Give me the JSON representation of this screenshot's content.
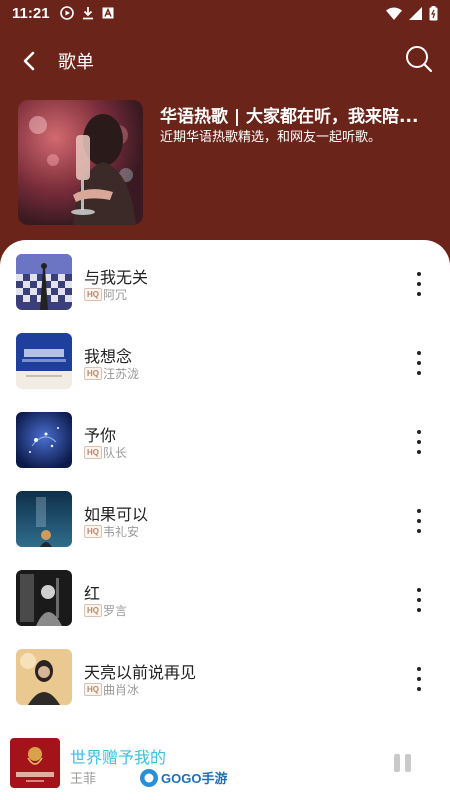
{
  "status_bar": {
    "time": "11:21",
    "icons": [
      "play-circle-icon",
      "download-icon",
      "a-icon",
      "wifi-icon",
      "signal-icon",
      "battery-icon"
    ]
  },
  "app_bar": {
    "title": "歌单",
    "back_icon": "back-arrow-icon",
    "search_icon": "search-icon"
  },
  "playlist": {
    "title": "华语热歌 | 大家都在听，我来陪...",
    "description": "近期华语热歌精选，和网友一起听歌。"
  },
  "quality_badge": "HQ",
  "songs": [
    {
      "title": "与我无关",
      "artist": "阿冗"
    },
    {
      "title": "我想念",
      "artist": "汪苏泷"
    },
    {
      "title": "予你",
      "artist": "队长"
    },
    {
      "title": "如果可以",
      "artist": "韦礼安"
    },
    {
      "title": "红",
      "artist": "罗言"
    },
    {
      "title": "天亮以前说再见",
      "artist": "曲肖冰"
    }
  ],
  "now_playing": {
    "title": "世界赠予我的",
    "artist": "王菲"
  },
  "watermark": "GOGO手游网",
  "colors": {
    "header_bg": "#6b241a",
    "accent": "#3cc0dc"
  }
}
